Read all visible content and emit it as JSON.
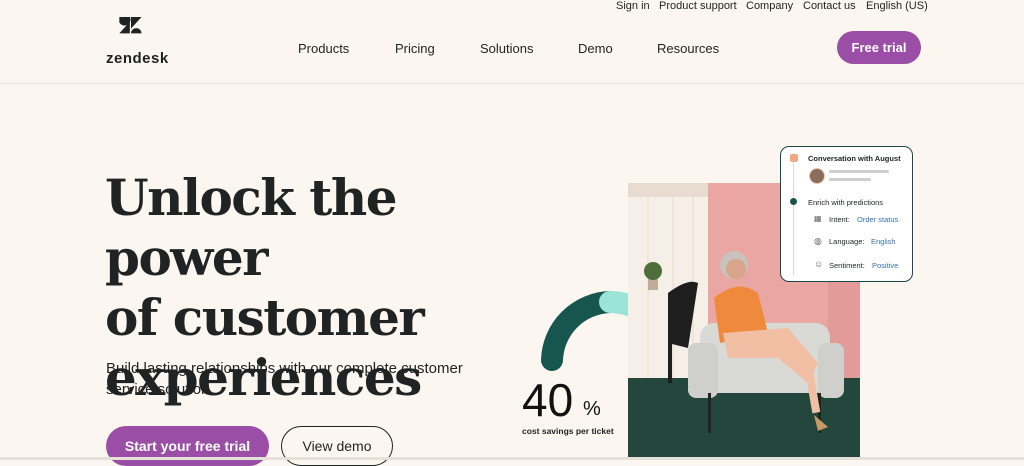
{
  "utility_nav": [
    "Sign in",
    "Product support",
    "Company",
    "Contact us",
    "English (US)"
  ],
  "brand": {
    "name": "zendesk"
  },
  "nav": [
    "Products",
    "Pricing",
    "Solutions",
    "Demo",
    "Resources"
  ],
  "header_cta": "Free trial",
  "hero": {
    "title_lines": [
      "Unlock the power",
      "of customer",
      "experiences"
    ],
    "subtitle": "Build lasting relationships with our complete customer service solution.",
    "primary_cta": "Start your free trial",
    "secondary_cta": "View demo"
  },
  "stat": {
    "value": "40",
    "unit": "%",
    "label": "cost savings per ticket"
  },
  "card": {
    "title": "Conversation with August",
    "section": "Enrich with predictions",
    "rows": [
      {
        "label": "Intent:",
        "value": "Order status",
        "icon": "grid-icon"
      },
      {
        "label": "Language:",
        "value": "English",
        "icon": "globe-icon"
      },
      {
        "label": "Sentiment:",
        "value": "Positive",
        "icon": "smiley-icon"
      }
    ]
  },
  "colors": {
    "accent": "#9b4ea5",
    "background": "#fbf6ef",
    "dark_teal": "#17494d",
    "link_blue": "#3471b8"
  }
}
